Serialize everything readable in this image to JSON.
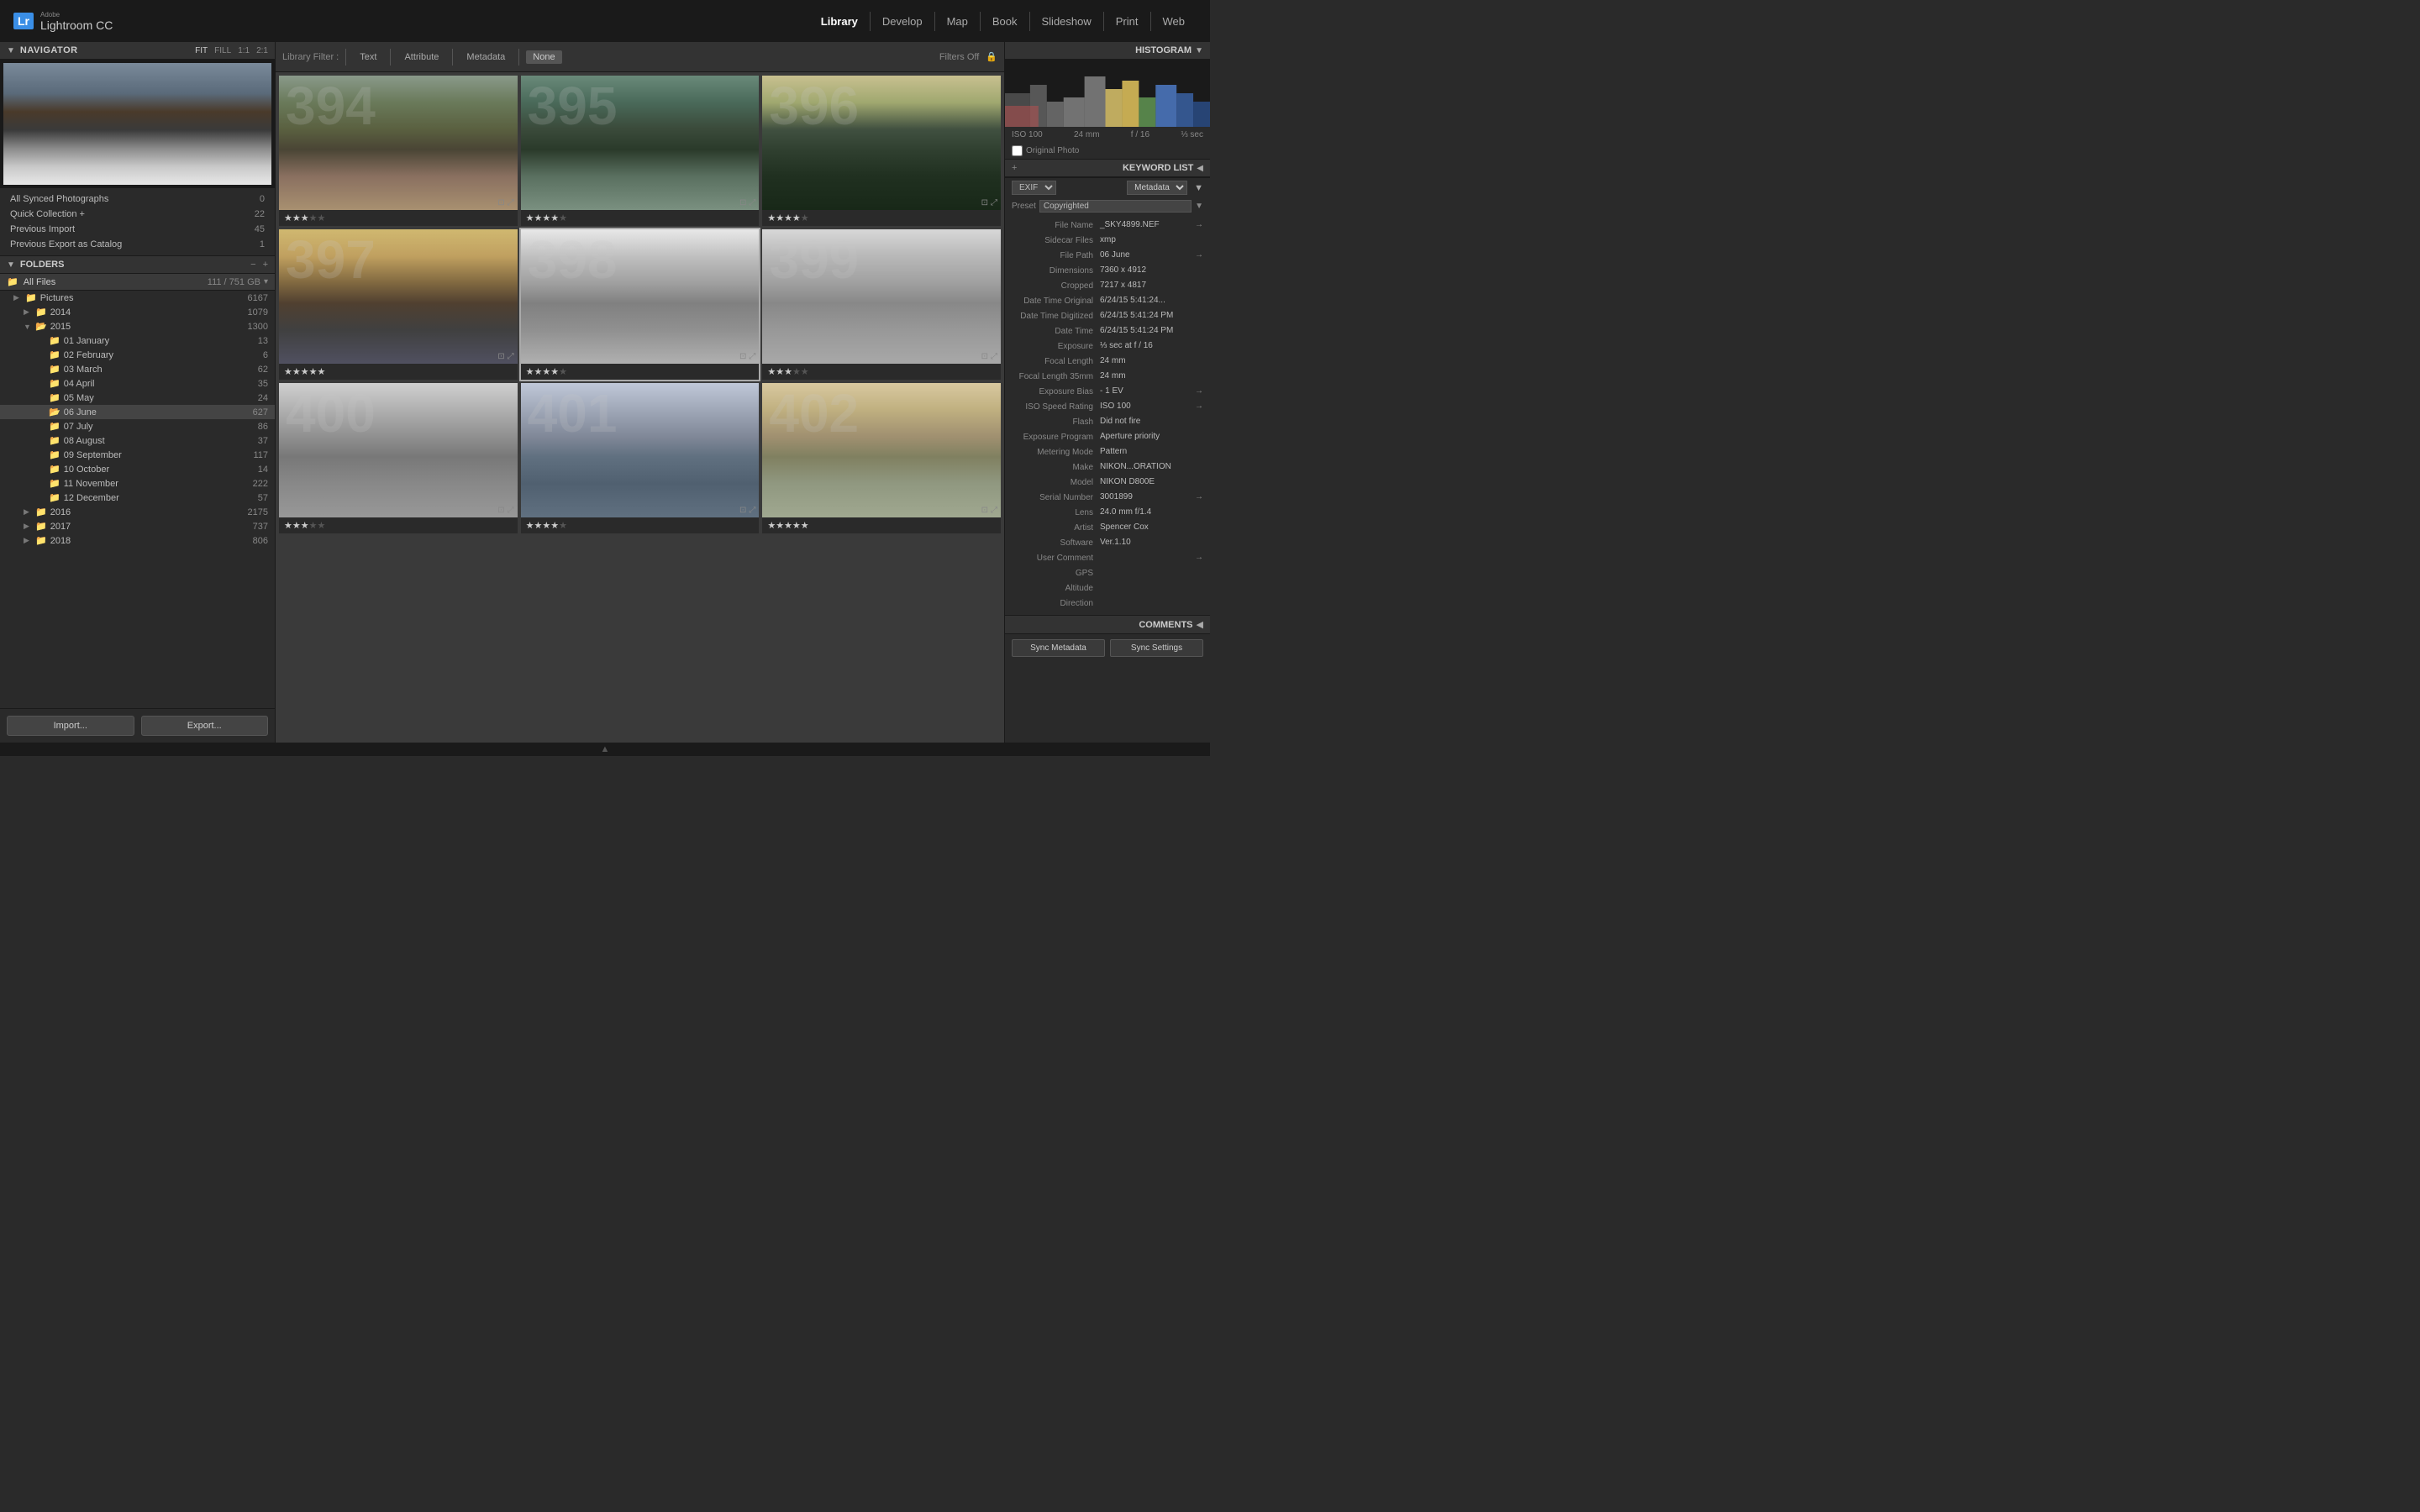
{
  "app": {
    "logo": "Lr",
    "adobe_label": "Adobe",
    "app_name": "Lightroom CC"
  },
  "topnav": {
    "items": [
      {
        "id": "library",
        "label": "Library",
        "active": true
      },
      {
        "id": "develop",
        "label": "Develop",
        "active": false
      },
      {
        "id": "map",
        "label": "Map",
        "active": false
      },
      {
        "id": "book",
        "label": "Book",
        "active": false
      },
      {
        "id": "slideshow",
        "label": "Slideshow",
        "active": false
      },
      {
        "id": "print",
        "label": "Print",
        "active": false
      },
      {
        "id": "web",
        "label": "Web",
        "active": false
      }
    ]
  },
  "navigator": {
    "title": "Navigator",
    "controls": [
      "FIT",
      "FILL",
      "1:1",
      "2:1"
    ]
  },
  "catalog": {
    "items": [
      {
        "label": "All Synced Photographs",
        "count": "0"
      },
      {
        "label": "Quick Collection",
        "count": "22",
        "plus": "+"
      },
      {
        "label": "Previous Import",
        "count": "45"
      },
      {
        "label": "Previous Export as Catalog",
        "count": "1"
      }
    ]
  },
  "folders": {
    "title": "Folders",
    "all_files": "All Files",
    "all_files_count": "111 / 751 GB",
    "tree": [
      {
        "level": 1,
        "expand": true,
        "icon": "folder",
        "name": "Pictures",
        "count": "6167"
      },
      {
        "level": 2,
        "expand": true,
        "icon": "folder",
        "name": "2014",
        "count": "1079"
      },
      {
        "level": 2,
        "expand": true,
        "icon": "folder-open",
        "name": "2015",
        "count": "1300"
      },
      {
        "level": 3,
        "expand": false,
        "icon": "folder",
        "name": "01 January",
        "count": "13"
      },
      {
        "level": 3,
        "expand": false,
        "icon": "folder",
        "name": "02 February",
        "count": "6"
      },
      {
        "level": 3,
        "expand": false,
        "icon": "folder",
        "name": "03 March",
        "count": "62"
      },
      {
        "level": 3,
        "expand": false,
        "icon": "folder",
        "name": "04 April",
        "count": "35"
      },
      {
        "level": 3,
        "expand": false,
        "icon": "folder",
        "name": "05 May",
        "count": "24"
      },
      {
        "level": 3,
        "expand": false,
        "icon": "folder-active",
        "name": "06 June",
        "count": "627"
      },
      {
        "level": 3,
        "expand": false,
        "icon": "folder",
        "name": "07 July",
        "count": "86"
      },
      {
        "level": 3,
        "expand": false,
        "icon": "folder",
        "name": "08 August",
        "count": "37"
      },
      {
        "level": 3,
        "expand": false,
        "icon": "folder",
        "name": "09 September",
        "count": "117"
      },
      {
        "level": 3,
        "expand": false,
        "icon": "folder",
        "name": "10 October",
        "count": "14"
      },
      {
        "level": 3,
        "expand": false,
        "icon": "folder",
        "name": "11 November",
        "count": "222"
      },
      {
        "level": 3,
        "expand": false,
        "icon": "folder",
        "name": "12 December",
        "count": "57"
      },
      {
        "level": 2,
        "expand": false,
        "icon": "folder",
        "name": "2016",
        "count": "2175"
      },
      {
        "level": 2,
        "expand": false,
        "icon": "folder",
        "name": "2017",
        "count": "737"
      },
      {
        "level": 2,
        "expand": false,
        "icon": "folder",
        "name": "2018",
        "count": "806"
      }
    ]
  },
  "panel_buttons": {
    "import": "Import...",
    "export": "Export..."
  },
  "filter_bar": {
    "label": "Library Filter :",
    "text_btn": "Text",
    "attribute_btn": "Attribute",
    "metadata_btn": "Metadata",
    "none_btn": "None",
    "filters_off": "Filters Off",
    "lock_icon": "🔒"
  },
  "grid": {
    "cells": [
      {
        "id": "394",
        "number": "394",
        "stars": 3,
        "selected": false,
        "photo_class": "photo-394"
      },
      {
        "id": "395",
        "number": "395",
        "stars": 4,
        "selected": false,
        "photo_class": "photo-395"
      },
      {
        "id": "396",
        "number": "396",
        "stars": 4,
        "selected": false,
        "photo_class": "photo-396"
      },
      {
        "id": "397",
        "number": "397",
        "stars": 5,
        "selected": false,
        "photo_class": "photo-397"
      },
      {
        "id": "398",
        "number": "398",
        "stars": 4,
        "selected": true,
        "photo_class": "photo-398"
      },
      {
        "id": "399",
        "number": "399",
        "stars": 3,
        "selected": false,
        "photo_class": "photo-399"
      },
      {
        "id": "400",
        "number": "400",
        "stars": 3,
        "selected": false,
        "photo_class": "photo-400"
      },
      {
        "id": "401",
        "number": "401",
        "stars": 4,
        "selected": false,
        "photo_class": "photo-401"
      },
      {
        "id": "402",
        "number": "402",
        "stars": 5,
        "selected": false,
        "photo_class": "photo-402"
      }
    ]
  },
  "histogram": {
    "title": "Histogram",
    "iso": "ISO 100",
    "focal_length": "24 mm",
    "aperture": "f / 16",
    "shutter": "⅓ sec",
    "original_photo": "Original Photo"
  },
  "keyword_list": {
    "title": "Keyword List",
    "plus": "+"
  },
  "metadata": {
    "title": "Metadata",
    "exif_label": "EXIF",
    "preset_label": "Preset",
    "preset_value": "Copyrighted",
    "rows": [
      {
        "label": "File Name",
        "value": "_SKY4899.NEF"
      },
      {
        "label": "Sidecar Files",
        "value": "xmp"
      },
      {
        "label": "File Path",
        "value": "06 June"
      },
      {
        "label": "Dimensions",
        "value": "7360 x 4912"
      },
      {
        "label": "Cropped",
        "value": "7217 x 4817"
      },
      {
        "label": "Date Time Original",
        "value": "6/24/15 5:41:24..."
      },
      {
        "label": "Date Time Digitized",
        "value": "6/24/15 5:41:24 PM"
      },
      {
        "label": "Date Time",
        "value": "6/24/15 5:41:24 PM"
      },
      {
        "label": "Exposure",
        "value": "⅓ sec at f / 16"
      },
      {
        "label": "Focal Length",
        "value": "24 mm"
      },
      {
        "label": "Focal Length 35mm",
        "value": "24 mm"
      },
      {
        "label": "Exposure Bias",
        "value": "- 1 EV"
      },
      {
        "label": "ISO Speed Rating",
        "value": "ISO 100"
      },
      {
        "label": "Flash",
        "value": "Did not fire"
      },
      {
        "label": "Exposure Program",
        "value": "Aperture priority"
      },
      {
        "label": "Metering Mode",
        "value": "Pattern"
      },
      {
        "label": "Make",
        "value": "NIKON...ORATION"
      },
      {
        "label": "Model",
        "value": "NIKON D800E"
      },
      {
        "label": "Serial Number",
        "value": "3001899"
      },
      {
        "label": "Lens",
        "value": "24.0 mm f/1.4"
      },
      {
        "label": "Artist",
        "value": "Spencer Cox"
      },
      {
        "label": "Software",
        "value": "Ver.1.10"
      },
      {
        "label": "User Comment",
        "value": ""
      },
      {
        "label": "GPS",
        "value": ""
      },
      {
        "label": "Altitude",
        "value": ""
      },
      {
        "label": "Direction",
        "value": ""
      }
    ]
  },
  "comments": {
    "title": "Comments"
  },
  "sync_buttons": {
    "sync_metadata": "Sync Metadata",
    "sync_settings": "Sync Settings"
  }
}
